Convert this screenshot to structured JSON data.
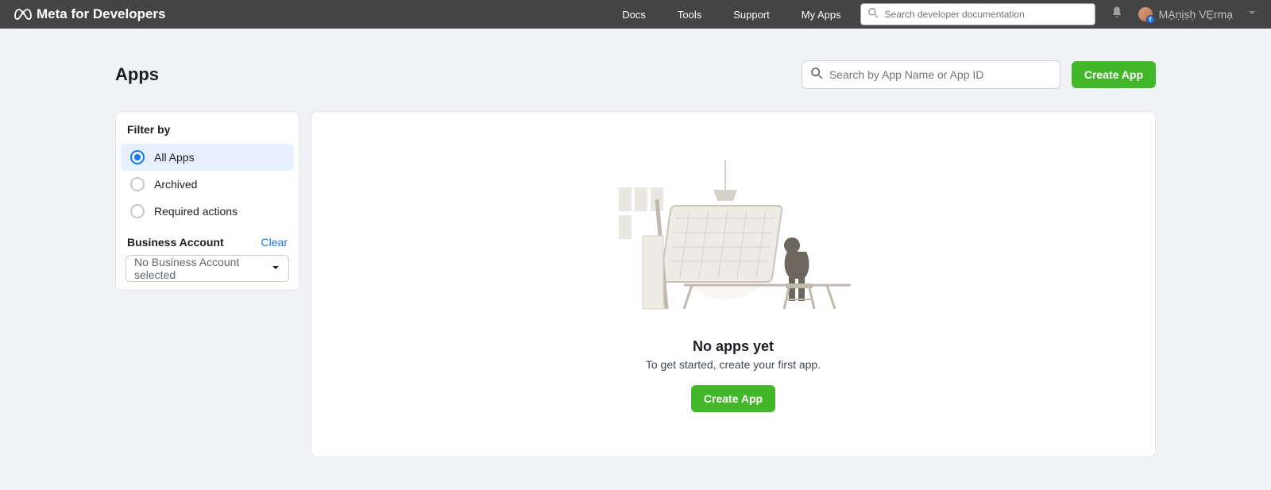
{
  "nav": {
    "brand": "Meta for Developers",
    "links": [
      "Docs",
      "Tools",
      "Support",
      "My Apps"
    ],
    "search_placeholder": "Search developer documentation",
    "user_name": "MA̱ṇịṣḥ VE̱rmạ"
  },
  "page": {
    "title": "Apps",
    "app_search_placeholder": "Search by App Name or App ID",
    "create_button": "Create App"
  },
  "sidebar": {
    "filter_title": "Filter by",
    "filters": [
      "All Apps",
      "Archived",
      "Required actions"
    ],
    "selected_filter_index": 0,
    "biz_label": "Business Account",
    "clear_label": "Clear",
    "biz_selected": "No Business Account selected"
  },
  "empty": {
    "title": "No apps yet",
    "subtitle": "To get started, create your first app.",
    "button": "Create App"
  }
}
